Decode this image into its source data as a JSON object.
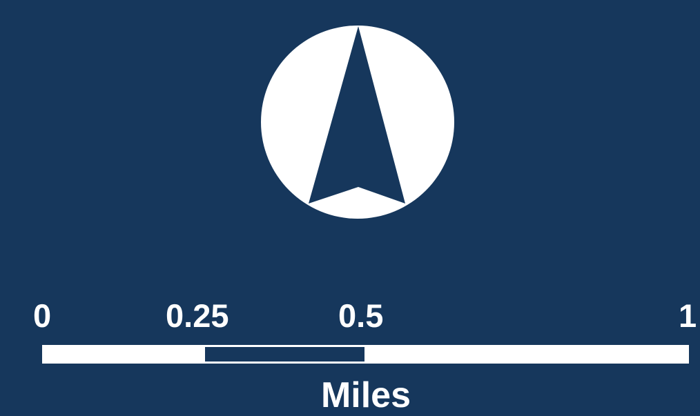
{
  "colors": {
    "background": "#16375c",
    "foreground": "#ffffff"
  },
  "north_arrow": {
    "icon": "north-arrow-icon"
  },
  "scale_bar": {
    "ticks": [
      "0",
      "0.25",
      "0.5",
      "1"
    ],
    "units": "Miles"
  }
}
